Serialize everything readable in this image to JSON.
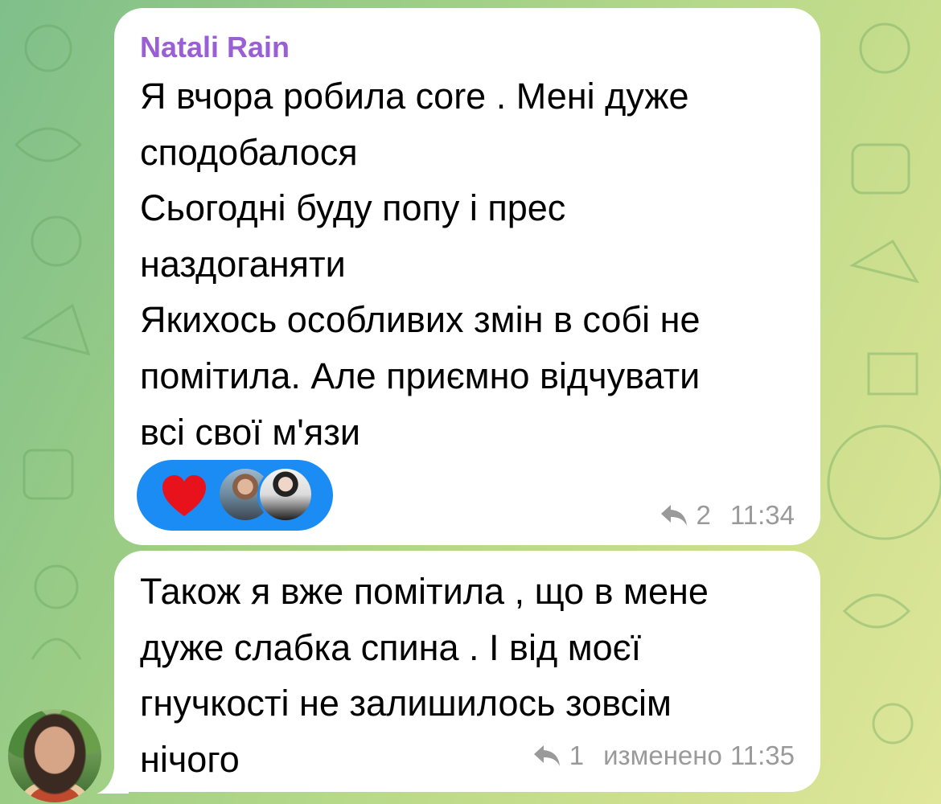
{
  "messages": [
    {
      "sender": "Natali Rain",
      "lines": [
        "Я вчора робила core . Мені дуже",
        "сподобалося",
        "Сьогодні буду попу і прес",
        "наздоганяти",
        "Якихось особливих змін в собі не",
        "помітила. Але приємно відчувати",
        "всі свої м'язи"
      ],
      "reactions": {
        "emoji": "heart-icon",
        "reactor_avatars": [
          "reactor-avatar-1",
          "reactor-avatar-2"
        ]
      },
      "reply_count": "2",
      "time": "11:34"
    },
    {
      "lines": [
        "Також я вже помітила , що в мене",
        "дуже слабка спина . І від моєї",
        "гнучкості не залишилось зовсім",
        "нічого"
      ],
      "reply_count": "1",
      "edited_label": "изменено",
      "time": "11:35"
    }
  ],
  "colors": {
    "sender_name": "#9a5fd4",
    "reaction_bg": "#1a8cf4",
    "heart": "#e8121c",
    "meta_text": "#9a9a9a"
  }
}
